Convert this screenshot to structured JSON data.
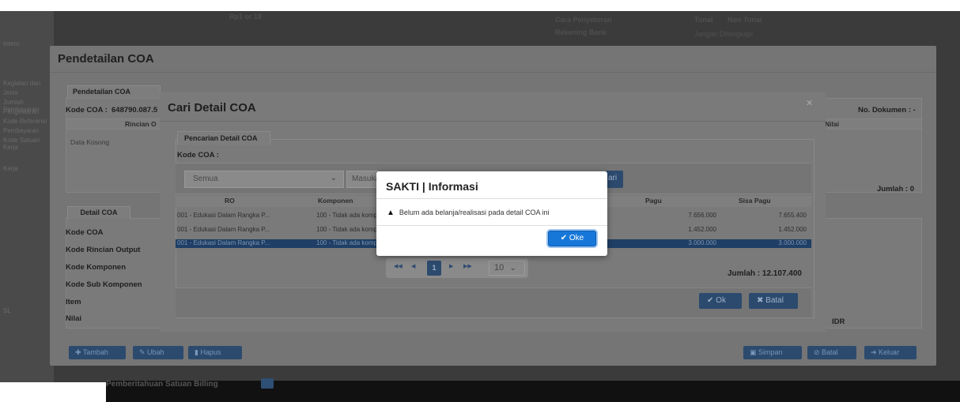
{
  "background": {
    "top_texts": [
      "Rp1 or 18",
      "Cara Penyetoran",
      "Rekening Bank",
      "Tunai",
      "Non Tunai",
      "Jangan Dilengkapi"
    ],
    "left_texts": [
      "Intern",
      "Kegiatan dan",
      "Jenis",
      "Jumlah Pembayaran",
      "Pengeluaran",
      "Kode Referensi",
      "Pembayaran",
      "Kode Satuan Kerja",
      "Kerja",
      "SL"
    ],
    "bottom_text": "Pemberitahuan Satuan Billing"
  },
  "pendetailan": {
    "title": "Pendetailan COA",
    "tab": "Pendetailan COA",
    "kode_coa_label": "Kode COA :",
    "kode_coa_value": "648790.087.5",
    "no_dokumen": "No. Dokumen : -",
    "col_rincian": "Rincian O",
    "col_nilai": "Nilai",
    "empty_text": "Data Kosong",
    "jumlah": "Jumlah : 0",
    "detail_tab": "Detail COA",
    "fields": [
      "Kode COA",
      "Kode Rincian Output",
      "Kode Komponen",
      "Kode Sub Komponen",
      "Item",
      "Nilai"
    ],
    "currency": "IDR",
    "buttons": {
      "tambah": "Tambah",
      "ubah": "Ubah",
      "hapus": "Hapus",
      "simpan": "Simpan",
      "batal": "Batal",
      "keluar": "Keluar"
    }
  },
  "cari": {
    "title": "Cari Detail COA",
    "tab": "Pencarian Detail COA",
    "kode_coa_label": "Kode COA :",
    "select_value": "Semua",
    "search_placeholder": "Masukan kata kunci",
    "cari_button": "ari",
    "columns": [
      "RO",
      "Komponen",
      "Pagu",
      "Sisa Pagu"
    ],
    "rows": [
      {
        "ro": "001 - Edukasi Dalam Rangka P...",
        "komponen": "100 - Tidak ada komponen",
        "pagu": "7.656.000",
        "sisa": "7.655.400"
      },
      {
        "ro": "001 - Edukasi Dalam Rangka P...",
        "komponen": "100 - Tidak ada komponen",
        "pagu": "1.452.000",
        "sisa": "1.452.000"
      },
      {
        "ro": "001 - Edukasi Dalam Rangka P...",
        "komponen": "100 - Tidak ada komponen",
        "pagu": "3.000.000",
        "sisa": "3.000.000"
      }
    ],
    "jumlah": "Jumlah : 12.107.400",
    "pager": {
      "current": "1",
      "page_size": "10"
    },
    "ok_button": "Ok",
    "batal_button": "Batal"
  },
  "info": {
    "title": "SAKTI | Informasi",
    "message": "Belum ada belanja/realisasi pada detail COA ini",
    "ok_button": "Oke"
  }
}
